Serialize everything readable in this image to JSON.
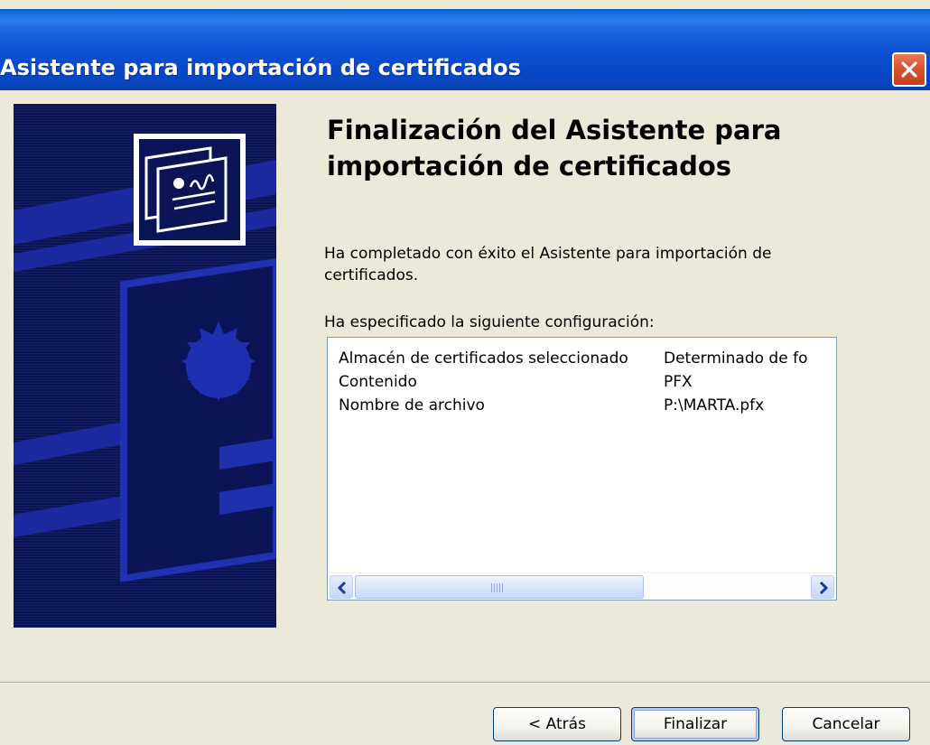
{
  "window": {
    "title": "Asistente para importación de certificados"
  },
  "wizard": {
    "heading": "Finalización del Asistente para importación de certificados",
    "description": "Ha completado con éxito el Asistente para importación de certificados.",
    "config_label": "Ha especificado la siguiente configuración:",
    "rows": [
      {
        "name": "Almacén de certificados seleccionado",
        "value": "Determinado de fo"
      },
      {
        "name": "Contenido",
        "value": "PFX"
      },
      {
        "name": "Nombre de archivo",
        "value": "P:\\MARTA.pfx"
      }
    ]
  },
  "buttons": {
    "back": "< Atrás",
    "finish": "Finalizar",
    "cancel": "Cancelar"
  },
  "icons": {
    "close": "close-icon",
    "certificate": "certificate-icon",
    "scroll_left": "chevron-left-icon",
    "scroll_right": "chevron-right-icon"
  },
  "colors": {
    "titlebar": "#0a53d0",
    "banner": "#0a1456",
    "dialog_bg": "#ece9d8",
    "close_button": "#d8502c"
  }
}
